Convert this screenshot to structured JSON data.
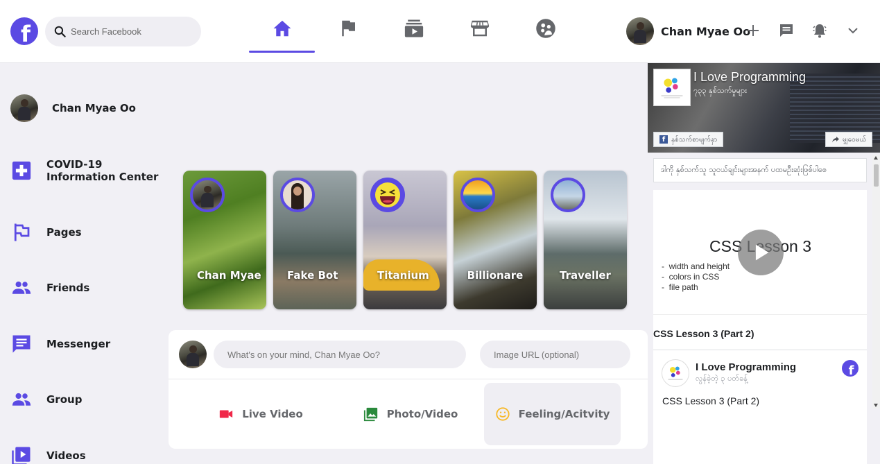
{
  "header": {
    "logo": "f",
    "search_placeholder": "Search Facebook",
    "nav_tabs": [
      {
        "name": "home",
        "icon": "home-icon",
        "active": true
      },
      {
        "name": "pages",
        "icon": "flag-icon",
        "active": false
      },
      {
        "name": "watch",
        "icon": "video-icon",
        "active": false
      },
      {
        "name": "marketplace",
        "icon": "store-icon",
        "active": false
      },
      {
        "name": "groups",
        "icon": "groups-icon",
        "active": false
      }
    ],
    "user_name": "Chan Myae Oo",
    "right_icons": [
      "plus-icon",
      "messenger-icon",
      "bell-icon",
      "chevron-down-icon"
    ]
  },
  "sidebar": {
    "user_name": "Chan Myae Oo",
    "items": [
      {
        "label": "COVID-19\nInformation Center",
        "icon": "covid-plus-icon"
      },
      {
        "label": "Pages",
        "icon": "flag-icon"
      },
      {
        "label": "Friends",
        "icon": "friends-icon"
      },
      {
        "label": "Messenger",
        "icon": "messenger-icon"
      },
      {
        "label": "Group",
        "icon": "group-icon"
      },
      {
        "label": "Videos",
        "icon": "videos-icon"
      }
    ]
  },
  "stories": [
    {
      "name": "Chan Myae"
    },
    {
      "name": "Fake Bot"
    },
    {
      "name": "Titanium"
    },
    {
      "name": "Billionare"
    },
    {
      "name": "Traveller"
    }
  ],
  "composer": {
    "post_placeholder": "What's on your mind, Chan Myae Oo?",
    "image_placeholder": "Image URL (optional)",
    "buttons": [
      {
        "label": "Live Video",
        "icon": "live-video-icon",
        "color": "#f02849"
      },
      {
        "label": "Photo/Video",
        "icon": "photo-icon",
        "color": "#45bd62"
      },
      {
        "label": "Feeling/Acitvity",
        "icon": "smile-icon",
        "color": "#f7b928"
      }
    ]
  },
  "right_panel": {
    "page_name": "I Love Programming",
    "page_sub": "၇၃၃ နှစ်သက်မှုများ",
    "like_button": "နှစ်သက်စာမျက်နှာ",
    "share_button": "မျှဝေမယ်",
    "friends_line": "ဒါကို နှစ်သက်သူ သူငယ်ချင်းများအနက် ပထမဦးဆုံးဖြစ်ပါစေ",
    "video": {
      "title": "CSS Lesson 3",
      "bullets": [
        "width and height",
        "colors in CSS",
        "file path"
      ]
    },
    "post_title": "CSS Lesson 3 (Part 2)",
    "post_author": "I Love Programming",
    "post_time": "လွန်ခဲ့တဲ့ ၃ ပတ်ခန့်",
    "post_body": "CSS Lesson 3 (Part 2)"
  },
  "colors": {
    "accent": "#5b4ae3",
    "background": "#f1f0f5"
  }
}
